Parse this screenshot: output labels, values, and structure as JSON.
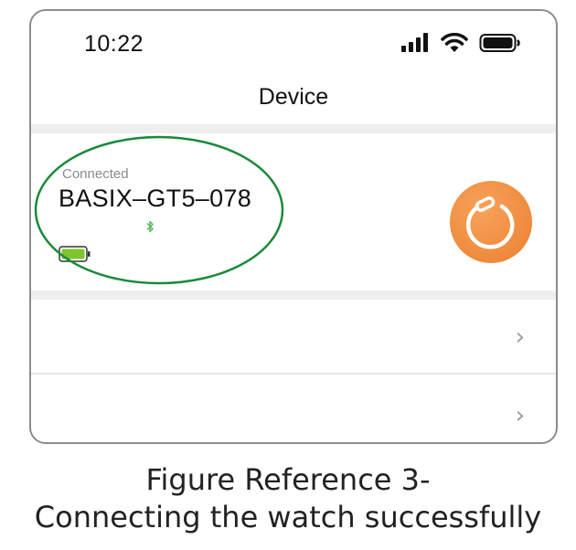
{
  "status_bar": {
    "time": "10:22",
    "icons": [
      "signal-icon",
      "wifi-icon",
      "battery-icon"
    ]
  },
  "header": {
    "title": "Device"
  },
  "device": {
    "status": "Connected",
    "name": "BASIX–GT5–078",
    "bluetooth_icon": "bluetooth-icon",
    "battery_icon": "battery-full-icon",
    "action_icon": "watch-refresh-icon",
    "accent_color": "#ee8a3d",
    "highlight_color": "#1a8a3a"
  },
  "list": {
    "rows": [
      {
        "label": "",
        "icon": "chevron-right-icon",
        "glyph": "›"
      },
      {
        "label": "",
        "icon": "chevron-right-icon",
        "glyph": "›"
      }
    ]
  },
  "caption": {
    "line1": "Figure Reference 3-",
    "line2": "Connecting the watch successfully"
  }
}
